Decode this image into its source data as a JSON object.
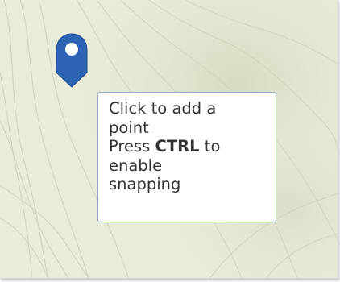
{
  "map": {
    "colors": {
      "terrain_base": "#e7ebd6",
      "terrain_light": "#eef1e0",
      "hill_shade": "#d4dac2",
      "contour_line": "#c9cfb8"
    }
  },
  "marker": {
    "icon": "map-pin-icon",
    "fill_color": "#2d63b3",
    "dot_color": "#ffffff"
  },
  "tooltip": {
    "line1": "Click to add a",
    "line2": "point",
    "line3_prefix": "Press",
    "line3_key": "CTRL",
    "line3_suffix": "to",
    "line4": "enable",
    "line5": "snapping"
  }
}
